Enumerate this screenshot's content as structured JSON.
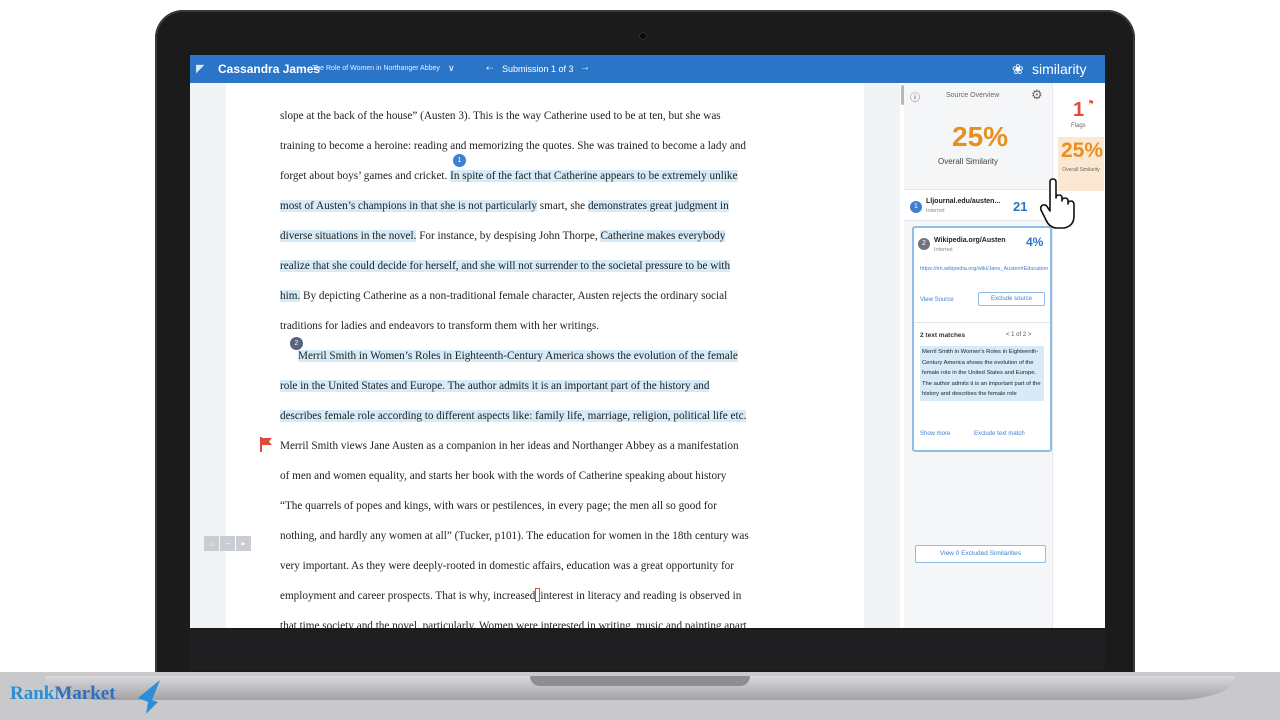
{
  "header": {
    "student_name": "Cassandra James",
    "assignment_title": "The Role of Women in Northanger Abbey",
    "submission_label": "Submission 1 of 3",
    "brand": "similarity"
  },
  "document": {
    "lines": [
      "slope at the back of the house” (Austen 3). This is the way Catherine used to be at ten, but she was",
      "training to become a heroine: reading and memorizing the quotes. She was trained to become a lady and",
      "forget about boys’ games and cricket. In spite of the fact that Catherine appears to be extremely unlike",
      "most of Austen’s champions in that she is not particularly smart, she demonstrates great judgment in",
      "diverse situations in the novel. For instance, by despising John Thorpe, Catherine makes everybody",
      "realize that she could decide for herself, and she will not surrender to the societal pressure to be with",
      "him. By depicting Catherine as a non-traditional female character, Austen rejects the ordinary social",
      "traditions for ladies and endeavors to transform them with her writings.",
      "Merril Smith in Women’s Roles in Eighteenth-Century America shows the evolution of the female",
      "role in the United States and Europe. The author admits it is an important part of the history and",
      "describes female role according to different aspects like: family life, marriage, religion, political life etc.",
      "Merril Smith views Jane Austen as a companion in her ideas and Northanger Abbey as a manifestation",
      "of men and women equality, and starts her book with the words of Catherine speaking about history",
      "“The quarrels of popes and kings, with wars or pestilences, in every page; the men all so good for",
      "nothing, and hardly any women at all” (Tucker, p101). The education for women in the 18th century was",
      "very important. As they were deeply-rooted in domestic affairs, education was a great opportunity for",
      "employment and career prospects. That is why, increased interest in literacy and reading is observed in",
      "that time society and the novel, particularly. Women were interested in writing, music and painting apart"
    ],
    "line3_plain": "forget about boys’ games and cricket. ",
    "line3_match": "In spite of the fact that Catherine appears to be extremely unlike",
    "line4_a": "most of Austen’s champions in that she is not particularly",
    "line4_b": " smart, she ",
    "line4_c": "demonstrates great judgment in",
    "line5_a": "diverse situations in the novel.",
    "line5_b": " For instance, by despising John Thorpe, ",
    "line5_c": "Catherine makes everybody",
    "line7_a": "him.",
    "line7_b": " By depicting Catherine as a non-traditional female character, Austen rejects the ordinary social",
    "line17_a": "employment and career prospects. That is why, increased",
    "line17_b": "interest in literacy and reading is observed in",
    "match_badges": [
      "1",
      "2"
    ]
  },
  "panel": {
    "source_mode": "Source Overview",
    "overall_percent": "25%",
    "overall_label": "Overall Similarity",
    "source1": {
      "number": "1",
      "name": "Lljournal.edu/austen...",
      "type": "Internet",
      "percent": "21"
    },
    "source2": {
      "number": "2",
      "name": "Wikipedia.org/Austen",
      "type": "Internet",
      "percent": "4%",
      "url": "https://en.wikipedia.org/wiki/Jane_Austen#Education",
      "view_label": "View Source",
      "exclude_label": "Exclude source",
      "text_matches": "2 text matches",
      "match_nav": "< 1 of 2 >",
      "snippet": "Merril Smith in Women's Roles in Eighteenth-Century America shows the evolution of the female role in the United States and Europe. The author admits it is an important part of the history and describes the female role",
      "show_more": "Show more",
      "exclude_text": "Exclude text match"
    },
    "view_excluded": "View 0 Excluded Similarities"
  },
  "rail": {
    "flags_count": "1",
    "flags_label": "Flags",
    "similarity_percent": "25%",
    "similarity_label": "Overall Similarity"
  },
  "watermark": {
    "part1": "Rank",
    "part2": "Market"
  },
  "colors": {
    "accent": "#2b75c9",
    "match_highlight": "#d6eaf8",
    "similarity_orange": "#e7901f",
    "flag_red": "#e04a3c"
  }
}
